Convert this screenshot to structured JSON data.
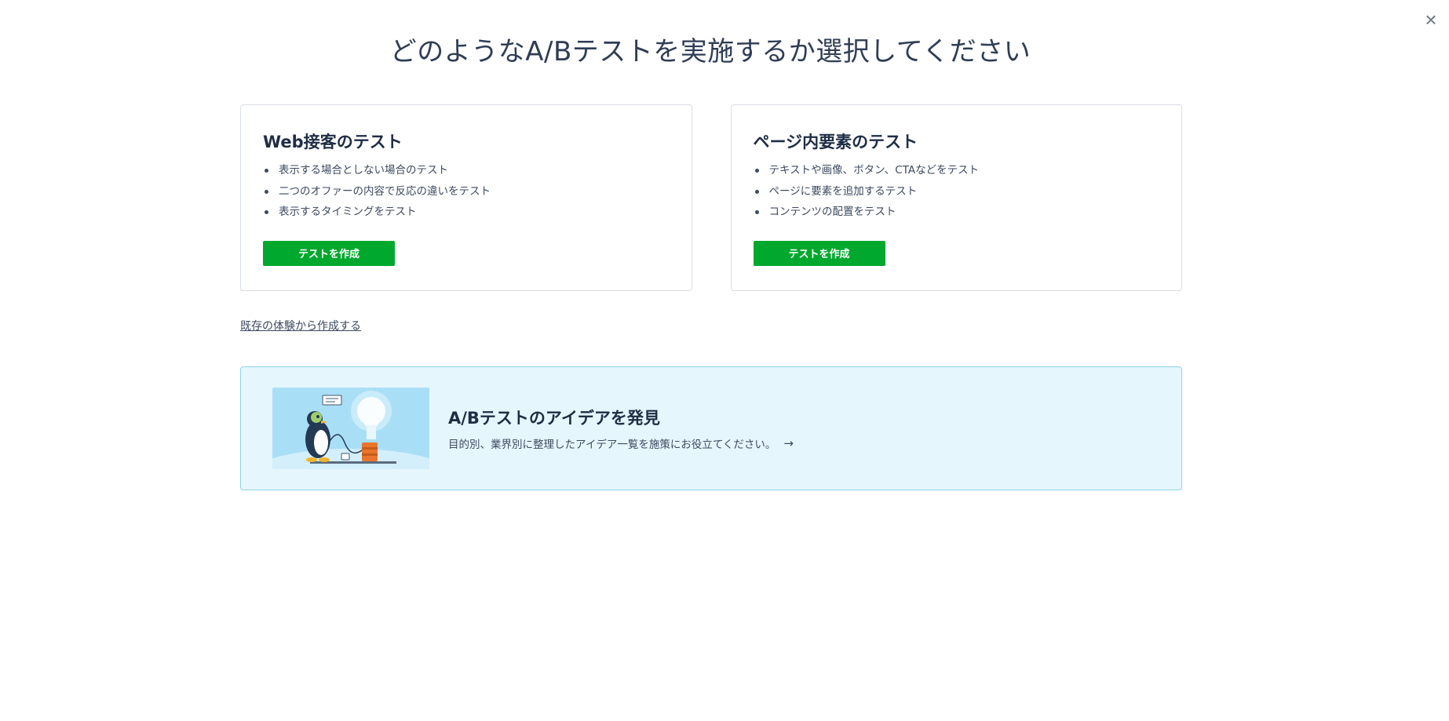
{
  "dialog": {
    "close_label": "×",
    "title": "どのようなA/Bテストを実施するか選択してください"
  },
  "cards": [
    {
      "title": "Web接客のテスト",
      "bullets": [
        "表示する場合としない場合のテスト",
        "二つのオファーの内容で反応の違いをテスト",
        "表示するタイミングをテスト"
      ],
      "button_label": "テストを作成"
    },
    {
      "title": "ページ内要素のテスト",
      "bullets": [
        "テキストや画像、ボタン、CTAなどをテスト",
        "ページに要素を追加するテスト",
        "コンテンツの配置をテスト"
      ],
      "button_label": "テストを作成"
    }
  ],
  "existing_link": "既存の体験から作成する",
  "idea_banner": {
    "title": "A/Bテストのアイデアを発見",
    "description": "目的別、業界別に整理したアイデア一覧を施策にお役立てください。",
    "arrow": "→",
    "illustration_icon": "penguin-lightbulb-illustration"
  },
  "colors": {
    "primary_button": "#00a82d",
    "banner_background": "#e6f6fd",
    "banner_border": "#8fd3ee",
    "text": "#2f3d55"
  }
}
